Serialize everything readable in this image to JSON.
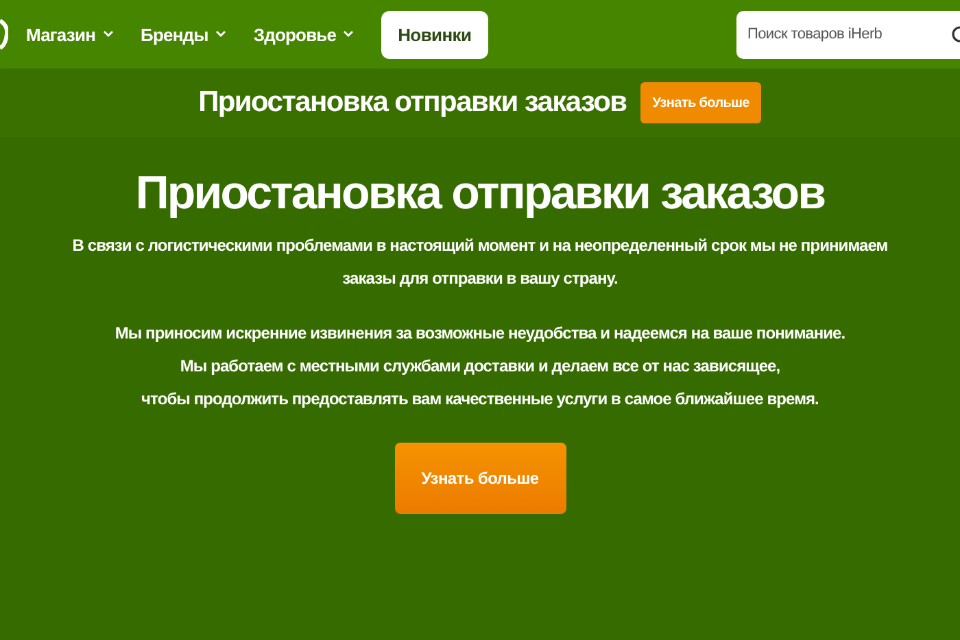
{
  "nav": {
    "items": [
      {
        "label": "Магазин",
        "kind": "dropdown"
      },
      {
        "label": "Бренды",
        "kind": "dropdown"
      },
      {
        "label": "Здоровье",
        "kind": "dropdown"
      },
      {
        "label": "Новинки",
        "kind": "button"
      }
    ],
    "search": {
      "placeholder": "Поиск товаров iHerb"
    }
  },
  "banner": {
    "title": "Приостановка отправки заказов",
    "button": "Узнать больше"
  },
  "main": {
    "title": "Приостановка отправки заказов",
    "paragraphs": [
      [
        "В связи с логистическими проблемами в настоящий момент и на неопределенный срок мы не принимаем",
        "заказы для отправки в вашу страну."
      ],
      [
        "Мы приносим искренние извинения за возможные неудобства и надеемся на ваше понимание.",
        "Мы работаем с местными службами доставки и делаем все от нас зависящее,",
        "чтобы продолжить предоставлять вам качественные услуги в самое ближайшее время."
      ]
    ],
    "button": "Узнать больше"
  }
}
